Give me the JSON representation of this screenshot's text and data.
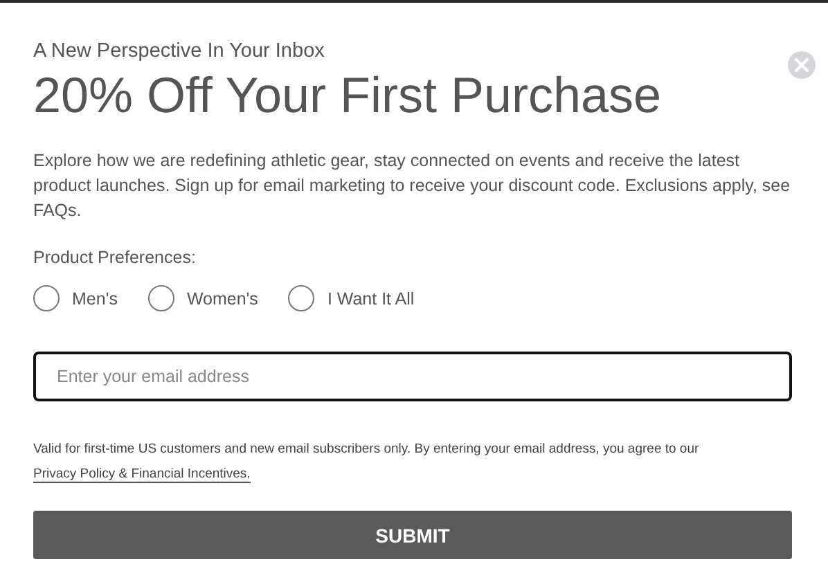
{
  "dialog": {
    "eyebrow": "A New Perspective In Your Inbox",
    "title": "20% Off Your First Purchase",
    "description": "Explore how we are redefining athletic gear, stay connected on events and receive the latest product launches. Sign up for email marketing to receive your discount code. Exclusions apply, see FAQs.",
    "preferences": {
      "label": "Product Preferences:",
      "options": [
        {
          "label": "Men's",
          "selected": false
        },
        {
          "label": "Women's",
          "selected": false
        },
        {
          "label": "I Want It All",
          "selected": false
        }
      ]
    },
    "email": {
      "placeholder": "Enter your email address"
    },
    "legal": {
      "text": "Valid for first-time US customers and new email subscribers only. By entering your email address, you agree to our",
      "link": "Privacy Policy & Financial Incentives."
    },
    "submit": "SUBMIT"
  }
}
